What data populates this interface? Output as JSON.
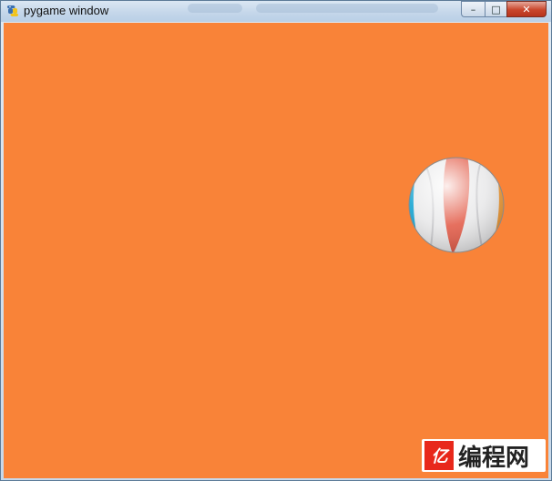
{
  "window": {
    "title": "pygame window",
    "buttons": {
      "minimize_icon": "minimize-icon",
      "maximize_icon": "maximize-icon",
      "close_icon": "close-icon",
      "minimize_glyph": "–",
      "maximize_glyph": "□",
      "close_glyph": "✕"
    },
    "app_icon": "pygame-snake-icon"
  },
  "canvas": {
    "background_color": "#f98338",
    "sprite": "beach-ball"
  },
  "watermark": {
    "logo_text": "亿",
    "text": "编程网"
  }
}
